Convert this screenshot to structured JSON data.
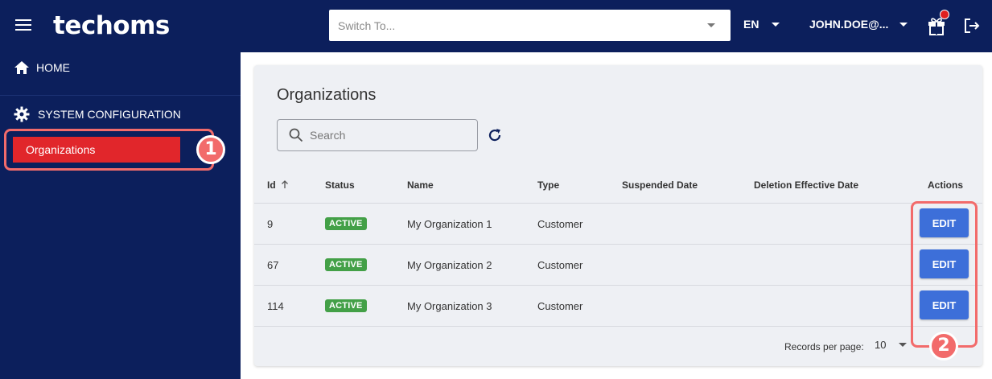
{
  "header": {
    "logo": "techoms",
    "switcher_placeholder": "Switch To...",
    "language": "EN",
    "user": "JOHN.DOE@...",
    "icons": [
      "hamburger-icon",
      "gift-icon",
      "logout-icon"
    ],
    "notification_dot_color": "#e02020"
  },
  "sidebar": {
    "home_label": "HOME",
    "system_config_label": "SYSTEM CONFIGURATION",
    "organizations_label": "Organizations",
    "active_color": "#e1262b"
  },
  "main": {
    "title": "Organizations",
    "search_placeholder": "Search",
    "columns": [
      "Id",
      "Status",
      "Name",
      "Type",
      "Suspended Date",
      "Deletion Effective Date",
      "Actions"
    ],
    "rows": [
      {
        "id": "9",
        "status": "ACTIVE",
        "name": "My Organization 1",
        "type": "Customer",
        "suspended": "",
        "deletion": "",
        "action": "EDIT"
      },
      {
        "id": "67",
        "status": "ACTIVE",
        "name": "My Organization 2",
        "type": "Customer",
        "suspended": "",
        "deletion": "",
        "action": "EDIT"
      },
      {
        "id": "114",
        "status": "ACTIVE",
        "name": "My Organization 3",
        "type": "Customer",
        "suspended": "",
        "deletion": "",
        "action": "EDIT"
      }
    ],
    "records_per_page_label": "Records per page:",
    "records_per_page_value": "10"
  },
  "callouts": [
    "1",
    "2"
  ],
  "colors": {
    "nav_bg": "#0c1f5c",
    "edit_button": "#3d6fd9",
    "status_active": "#43a047",
    "callout": "#f26b6b"
  }
}
